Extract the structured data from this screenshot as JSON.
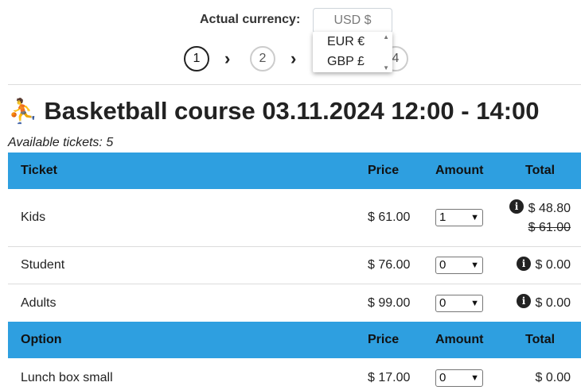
{
  "currency": {
    "label": "Actual currency:",
    "selected": "USD $",
    "options": [
      "EUR €",
      "GBP £"
    ]
  },
  "steps": [
    "1",
    "2",
    "3",
    "4"
  ],
  "step_chevron": "›",
  "event": {
    "emoji": "⛹",
    "title": "Basketball course 03.11.2024 12:00 - 14:00",
    "available": "Available tickets: 5"
  },
  "ticket_table": {
    "headers": {
      "name": "Ticket",
      "price": "Price",
      "amount": "Amount",
      "total": "Total"
    },
    "rows": [
      {
        "name": "Kids",
        "price": "$ 61.00",
        "amount": "1",
        "total": "$ 48.80",
        "original_total": "$ 61.00"
      },
      {
        "name": "Student",
        "price": "$ 76.00",
        "amount": "0",
        "total": "$ 0.00"
      },
      {
        "name": "Adults",
        "price": "$ 99.00",
        "amount": "0",
        "total": "$ 0.00"
      }
    ]
  },
  "option_table": {
    "headers": {
      "name": "Option",
      "price": "Price",
      "amount": "Amount",
      "total": "Total"
    },
    "rows": [
      {
        "name": "Lunch box small",
        "price": "$ 17.00",
        "amount": "0",
        "total": "$ 0.00"
      }
    ]
  },
  "colors": {
    "header_bg": "#2e9fe0",
    "active_step_border": "#222222"
  }
}
